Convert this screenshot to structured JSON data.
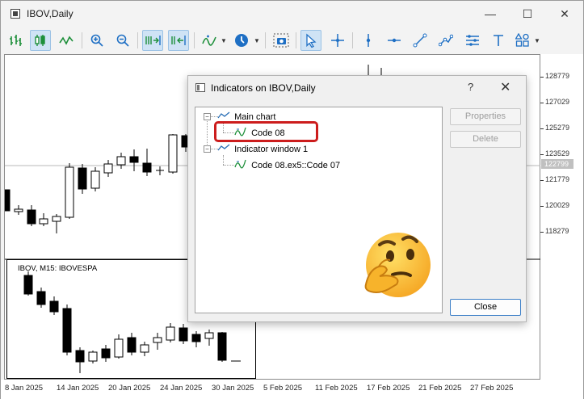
{
  "window": {
    "title": "IBOV,Daily",
    "minimize_glyph": "—",
    "maximize_glyph": "☐",
    "close_glyph": "✕"
  },
  "toolbar": {
    "items": [
      "bar-chart-icon",
      "candlestick-icon",
      "line-chart-icon",
      "zoom-in-icon",
      "zoom-out-icon",
      "auto-scroll-icon",
      "chart-shift-icon",
      "indicators-icon",
      "periods-icon",
      "screenshot-icon",
      "cursor-icon",
      "crosshair-icon",
      "vertical-line-icon",
      "horizontal-line-icon",
      "trendline-icon",
      "channel-icon",
      "fibonacci-icon",
      "text-icon",
      "shapes-icon"
    ],
    "dropdown_glyph": "▼"
  },
  "chart": {
    "prices": [
      "128779",
      "127029",
      "125279",
      "123529",
      "122799",
      "121779",
      "120029",
      "118279"
    ],
    "current_price": "122799",
    "dates": [
      "8 Jan 2025",
      "14 Jan 2025",
      "20 Jan 2025",
      "24 Jan 2025",
      "30 Jan 2025",
      "5 Feb 2025",
      "11 Feb 2025",
      "17 Feb 2025",
      "21 Feb 2025",
      "27 Feb 2025"
    ],
    "subwindow_label": "IBOV, M15:  IBOVESPA"
  },
  "dialog": {
    "title": "Indicators on IBOV,Daily",
    "help_glyph": "?",
    "close_glyph": "✕",
    "tree": {
      "main_chart": "Main chart",
      "main_item": "Code 08",
      "indicator_window": "Indicator window 1",
      "window_item": "Code 08.ex5::Code 07"
    },
    "expander_glyph": "−",
    "buttons": {
      "properties": "Properties",
      "delete": "Delete",
      "close": "Close"
    }
  },
  "colors": {
    "accent": "#1e6fc4",
    "highlight": "#cc1d1d",
    "toolbar_active": "#cfe3f5"
  }
}
